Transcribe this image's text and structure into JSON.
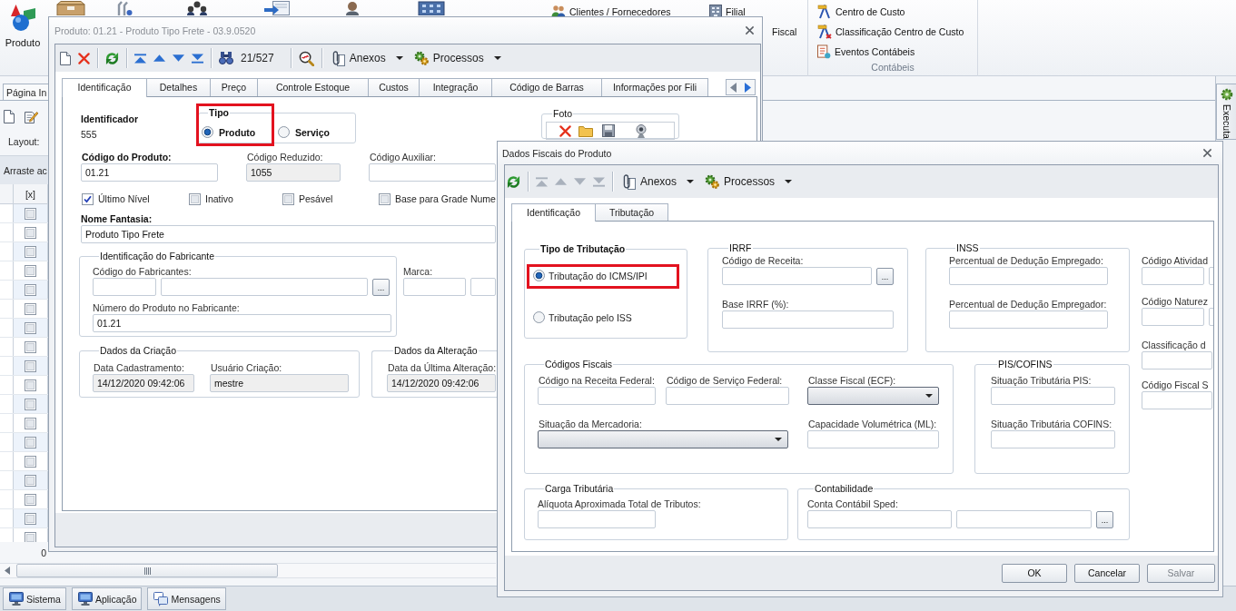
{
  "ribbon": {
    "large_buttons": [
      {
        "label": "Produto"
      }
    ],
    "items": [
      {
        "label": "Clientes / Fornecedores"
      },
      {
        "label": "Filial"
      },
      {
        "label": "Fiscal"
      }
    ],
    "groups": [
      {
        "label": "Contábeis",
        "items": [
          {
            "label": "Centro de Custo"
          },
          {
            "label": "Classificação Centro de Custo"
          },
          {
            "label": "Eventos Contábeis"
          }
        ]
      }
    ]
  },
  "workspace": {
    "tab": "Página In",
    "layout_label": "Layout:",
    "group_hint": "Arraste ac",
    "grid": {
      "columns": [
        "[x]"
      ],
      "rows": [
        {
          "checked": false
        },
        {
          "checked": false
        },
        {
          "checked": false
        },
        {
          "checked": false
        },
        {
          "checked": false
        },
        {
          "checked": false
        },
        {
          "checked": false
        },
        {
          "checked": false
        },
        {
          "checked": false
        },
        {
          "checked": false
        },
        {
          "checked": false
        },
        {
          "checked": false
        },
        {
          "checked": false
        },
        {
          "checked": false
        },
        {
          "checked": false
        },
        {
          "checked": false
        },
        {
          "checked": false
        },
        {
          "checked": false
        }
      ],
      "footer": "0"
    },
    "side_panel": {
      "label": "Executa"
    },
    "taskbar": [
      {
        "label": "Sistema"
      },
      {
        "label": "Aplicação"
      },
      {
        "label": "Mensagens"
      }
    ]
  },
  "product_window": {
    "title": "Produto: 01.21 - Produto Tipo Frete - 03.9.0520",
    "active": false,
    "toolbar": {
      "navigation_disabled": false,
      "record_counter": "21/527",
      "menus": [
        {
          "label": "Anexos"
        },
        {
          "label": "Processos"
        }
      ]
    },
    "tabs": [
      {
        "label": "Identificação",
        "selected": true
      },
      {
        "label": "Detalhes",
        "selected": false
      },
      {
        "label": "Preço",
        "selected": false
      },
      {
        "label": "Controle Estoque",
        "selected": false
      },
      {
        "label": "Custos",
        "selected": false
      },
      {
        "label": "Integração",
        "selected": false
      },
      {
        "label": "Código de Barras",
        "selected": false
      },
      {
        "label": "Informações por Fili",
        "selected": false
      }
    ],
    "identificador": {
      "label": "Identificador",
      "value": "555"
    },
    "tipo": {
      "label": "Tipo",
      "highlighted": true,
      "options": [
        {
          "label": "Produto",
          "selected": true
        },
        {
          "label": "Serviço",
          "selected": false
        }
      ]
    },
    "foto": {
      "label": "Foto"
    },
    "codigo_do_produto": {
      "label": "Código do Produto:",
      "value": "01.21",
      "disabled": false
    },
    "codigo_reduzido": {
      "label": "Código Reduzido:",
      "value": "1055",
      "disabled": true
    },
    "codigo_auxiliar": {
      "label": "Código Auxiliar:",
      "disabled": false
    },
    "flags": [
      {
        "label": "Último Nível",
        "checked": true
      },
      {
        "label": "Inativo",
        "checked": false
      },
      {
        "label": "Pesável",
        "checked": false
      },
      {
        "label": "Base para Grade Nume",
        "checked": false
      }
    ],
    "nome_fantasia": {
      "label": "Nome Fantasia:",
      "value": "Produto Tipo Frete",
      "disabled": false
    },
    "fabricante": {
      "label": "Identificação do Fabricante",
      "fields": [
        {
          "label": "Código do Fabricantes:",
          "kind": "lookup",
          "button": "..."
        },
        {
          "label": "Número do Produto no Fabricante:",
          "kind": "text",
          "value": "01.21",
          "disabled": false
        }
      ]
    },
    "marca": {
      "label": "Marca:"
    },
    "dados_criacao": {
      "label": "Dados da Criação",
      "fields": [
        {
          "label": "Data Cadastramento:",
          "value": "14/12/2020 09:42:06",
          "disabled": true
        },
        {
          "label": "Usuário Criação:",
          "value": "mestre",
          "disabled": true
        }
      ]
    },
    "dados_alteracao": {
      "label": "Dados da Alteração",
      "fields": [
        {
          "label": "Data da Última Alteração:",
          "value": "14/12/2020 09:42:06",
          "disabled": true
        }
      ]
    }
  },
  "fiscal_dialog": {
    "title": "Dados Fiscais do Produto",
    "active": true,
    "toolbar": {
      "navigation_disabled": true,
      "menus": [
        {
          "label": "Anexos"
        },
        {
          "label": "Processos"
        }
      ]
    },
    "tabs": [
      {
        "label": "Identificação",
        "selected": true
      },
      {
        "label": "Tributação",
        "selected": false
      }
    ],
    "tipo_de_tributacao": {
      "label": "Tipo de Tributação",
      "options": [
        {
          "label": "Tributação do ICMS/IPI",
          "selected": true,
          "highlighted": true
        },
        {
          "label": "Tributação pelo ISS",
          "selected": false,
          "highlighted": false
        }
      ]
    },
    "irrf": {
      "label": "IRRF",
      "fields": [
        {
          "label": "Código de Receita:",
          "kind": "lookup",
          "button": "..."
        },
        {
          "label": "Base IRRF (%):",
          "kind": "text"
        }
      ]
    },
    "inss": {
      "label": "INSS",
      "fields": [
        {
          "label": "Percentual de Dedução Empregado:"
        },
        {
          "label": "Percentual de Dedução Empregador:"
        }
      ]
    },
    "side_fields": [
      {
        "label": "Código Atividad"
      },
      {
        "label": "Código Naturez"
      },
      {
        "label": "Classificação d"
      },
      {
        "label": "Código Fiscal S"
      }
    ],
    "codigos_fiscais": {
      "label": "Códigos Fiscais",
      "fields": [
        {
          "label": "Código na Receita Federal:",
          "kind": "text"
        },
        {
          "label": "Código de Serviço Federal:",
          "kind": "text"
        },
        {
          "label": "Classe Fiscal (ECF):",
          "kind": "select"
        },
        {
          "label": "Situação da Mercadoria:",
          "kind": "select"
        },
        {
          "label": "Capacidade Volumétrica (ML):",
          "kind": "text"
        }
      ]
    },
    "pis_cofins": {
      "label": "PIS/COFINS",
      "fields": [
        {
          "label": "Situação Tributária PIS:"
        },
        {
          "label": "Situação Tributária COFINS:"
        }
      ]
    },
    "carga_tributaria": {
      "label": "Carga Tributária",
      "fields": [
        {
          "label": "Alíquota Aproximada Total de Tributos:"
        }
      ]
    },
    "contabilidade": {
      "label": "Contabilidade",
      "fields": [
        {
          "label": "Conta Contábil Sped:",
          "kind": "lookup",
          "button": "..."
        }
      ]
    },
    "buttons": [
      {
        "label": "OK",
        "disabled": false
      },
      {
        "label": "Cancelar",
        "disabled": false
      },
      {
        "label": "Salvar",
        "disabled": true
      }
    ]
  }
}
